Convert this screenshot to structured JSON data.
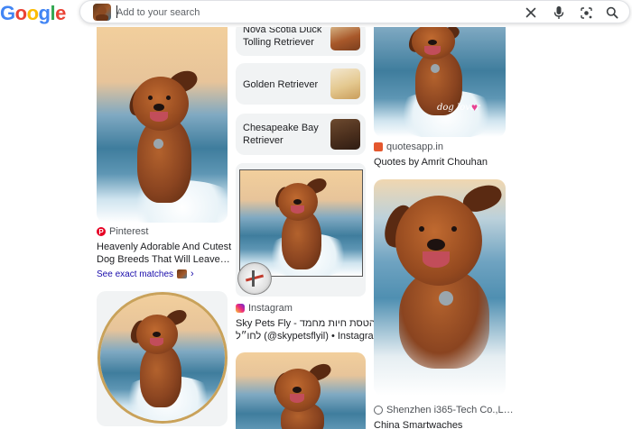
{
  "header": {
    "logo": [
      "G",
      "o",
      "o",
      "g",
      "l",
      "e"
    ],
    "logo_colors": [
      "#4285F4",
      "#EA4335",
      "#FBBC05",
      "#4285F4",
      "#34A853",
      "#EA4335"
    ],
    "search_placeholder": "Add to your search",
    "icons": [
      "close-icon",
      "microphone-icon",
      "lens-icon",
      "search-icon"
    ]
  },
  "column1": {
    "result1": {
      "source": "Pinterest",
      "source_color": "#e60023",
      "title_line1": "Heavenly Adorable And Cutest",
      "title_line2": "Dog Breeds That Will Leave…",
      "exact_matches": "See exact matches"
    }
  },
  "column2": {
    "chips": [
      {
        "label": "Nova Scotia Duck Tolling Retriever"
      },
      {
        "label": "Golden Retriever"
      },
      {
        "label": "Chesapeake Bay Retriever"
      }
    ],
    "result1": {
      "source": "Instagram",
      "title_line1": "Sky Pets Fly - הטסת חיות מחמד",
      "title_line2": "לחו״ל (@skypetsflyil) • Instagra…"
    }
  },
  "column3": {
    "result1": {
      "source": "quotesapp.in",
      "title": "Quotes by Amrit Chouhan",
      "watermark": "dog lover"
    },
    "result2": {
      "source": "Shenzhen i365-Tech Co.,L…",
      "title": "China Smartwaches"
    }
  },
  "colors": {
    "link": "#1a0dab",
    "chip_bg": "#f1f3f4",
    "text": "#202124",
    "muted": "#4d5156"
  }
}
